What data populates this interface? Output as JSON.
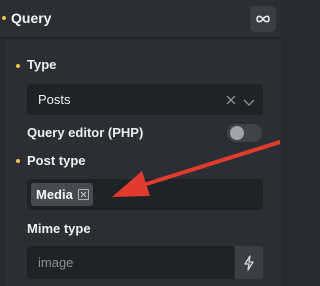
{
  "header": {
    "title": "Query"
  },
  "fields": {
    "type": {
      "label": "Type",
      "value": "Posts"
    },
    "query_editor": {
      "label": "Query editor (PHP)",
      "enabled": false
    },
    "post_type": {
      "label": "Post type",
      "tags": [
        {
          "label": "Media"
        }
      ]
    },
    "mime_type": {
      "label": "Mime type",
      "placeholder": "image"
    }
  },
  "colors": {
    "accent_dot": "#f0c44e",
    "annotation_arrow": "#e23b2e",
    "background": "#2b2f35",
    "input_bg": "#1f2226"
  },
  "icons": {
    "loop": "infinity-icon",
    "clear": "x-icon",
    "dropdown": "chevron-down-icon",
    "tag_remove": "square-x-icon",
    "dynamic_data": "bolt-icon"
  }
}
